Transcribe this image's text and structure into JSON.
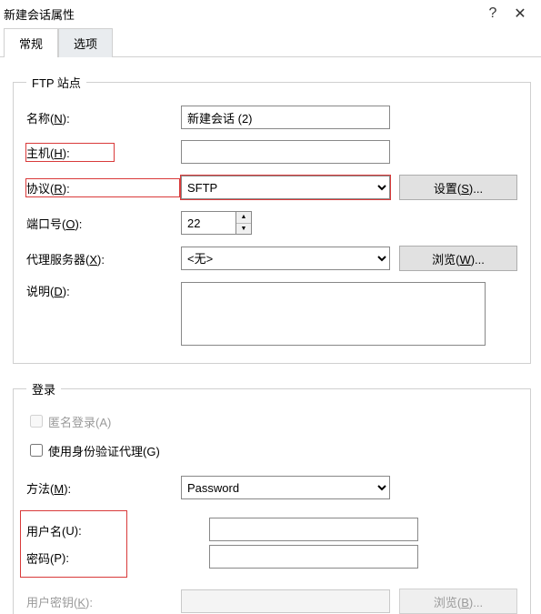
{
  "window": {
    "title": "新建会话属性",
    "help": "?",
    "close": "✕"
  },
  "tabs": {
    "general": "常规",
    "options": "选项"
  },
  "ftp": {
    "legend": "FTP 站点",
    "name_label_pre": "名称(",
    "name_label_u": "N",
    "name_label_post": "):",
    "name_value": "新建会话 (2)",
    "host_label_pre": "主机(",
    "host_label_u": "H",
    "host_label_post": "):",
    "host_value": "",
    "proto_label_pre": "协议(",
    "proto_label_u": "R",
    "proto_label_post": "):",
    "proto_value": "SFTP",
    "setup_pre": "设置(",
    "setup_u": "S",
    "setup_post": ")...",
    "port_label_pre": "端口号(",
    "port_label_u": "O",
    "port_label_post": "):",
    "port_value": "22",
    "proxy_label_pre": "代理服务器(",
    "proxy_label_u": "X",
    "proxy_label_post": "):",
    "proxy_value": "<无>",
    "browse_pre": "浏览(",
    "browse_u": "W",
    "browse_post": ")...",
    "desc_label_pre": "说明(",
    "desc_label_u": "D",
    "desc_label_post": "):",
    "desc_value": ""
  },
  "login": {
    "legend": "登录",
    "anon_pre": "匿名登录(",
    "anon_u": "A",
    "anon_post": ")",
    "agent_pre": "使用身份验证代理(",
    "agent_u": "G",
    "agent_post": ")",
    "method_label_pre": "方法(",
    "method_label_u": "M",
    "method_label_post": "):",
    "method_value": "Password",
    "user_label_pre": "用户名(",
    "user_label_u": "U",
    "user_label_post": "):",
    "user_value": "",
    "pass_label_pre": "密码(",
    "pass_label_u": "P",
    "pass_label_post": "):",
    "pass_value": "",
    "key_label_pre": "用户密钥(",
    "key_label_u": "K",
    "key_label_post": "):",
    "key_value": "",
    "browse2_pre": "浏览(",
    "browse2_u": "B",
    "browse2_post": ")..."
  }
}
